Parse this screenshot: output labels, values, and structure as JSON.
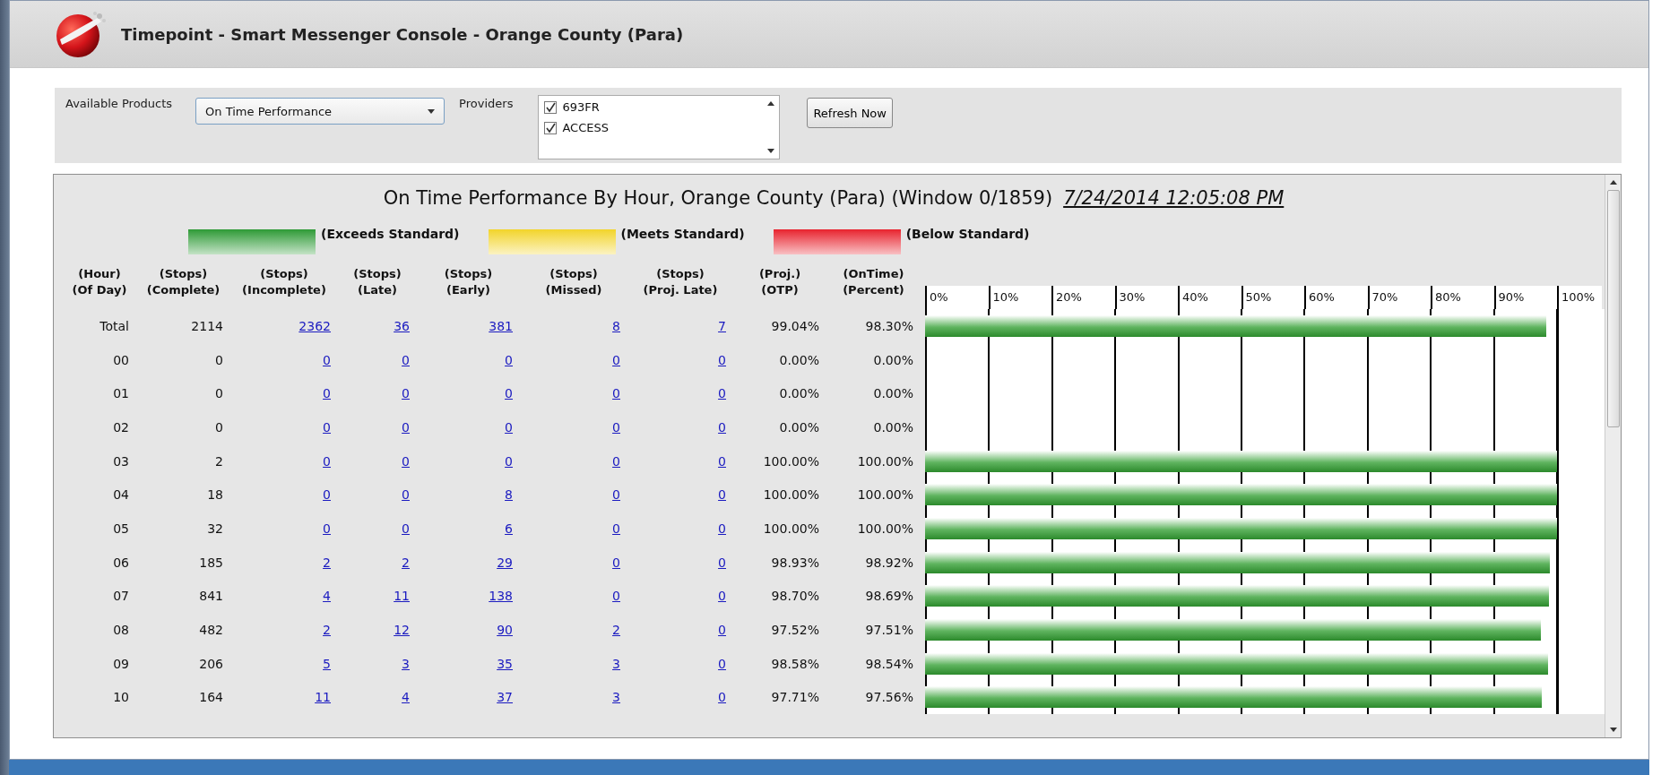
{
  "window": {
    "title": "Timepoint - Smart Messenger Console - Orange County (Para)"
  },
  "controls": {
    "products_label": "Available Products",
    "product": "On Time Performance",
    "providers_label": "Providers",
    "providers": [
      {
        "label": "693FR",
        "checked": true
      },
      {
        "label": "ACCESS",
        "checked": true
      }
    ],
    "refresh_button": "Refresh Now"
  },
  "report": {
    "title": "On Time Performance By Hour, Orange County (Para) (Window 0/1859)",
    "timestamp": "7/24/2014 12:05:08 PM",
    "legend": [
      {
        "label": "(Exceeds Standard)",
        "color": "#2e9a36"
      },
      {
        "label": "(Meets Standard)",
        "color": "#f2d42a"
      },
      {
        "label": "(Below Standard)",
        "color": "#e8232e"
      }
    ],
    "columns": [
      {
        "label": "(Hour)\n(Of Day)",
        "link": false
      },
      {
        "label": "(Stops)\n(Complete)",
        "link": false
      },
      {
        "label": "(Stops)\n(Incomplete)",
        "link": true
      },
      {
        "label": "(Stops)\n(Late)",
        "link": true
      },
      {
        "label": "(Stops)\n(Early)",
        "link": true
      },
      {
        "label": "(Stops)\n(Missed)",
        "link": true
      },
      {
        "label": "(Stops)\n(Proj. Late)",
        "link": true
      },
      {
        "label": "(Proj.)\n(OTP)",
        "link": false
      },
      {
        "label": "(OnTime)\n(Percent)",
        "link": false
      }
    ],
    "scale": [
      "0%",
      "10%",
      "20%",
      "30%",
      "40%",
      "50%",
      "60%",
      "70%",
      "80%",
      "90%",
      "100%"
    ],
    "rows": [
      {
        "cells": [
          "Total",
          "2114",
          "2362",
          "36",
          "381",
          "8",
          "7",
          "99.04%",
          "98.30%"
        ],
        "level": 0.983
      },
      {
        "cells": [
          "00",
          "0",
          "0",
          "0",
          "0",
          "0",
          "0",
          "0.00%",
          "0.00%"
        ]
      },
      {
        "cells": [
          "01",
          "0",
          "0",
          "0",
          "0",
          "0",
          "0",
          "0.00%",
          "0.00%"
        ]
      },
      {
        "cells": [
          "02",
          "0",
          "0",
          "0",
          "0",
          "0",
          "0",
          "0.00%",
          "0.00%"
        ]
      },
      {
        "cells": [
          "03",
          "2",
          "0",
          "0",
          "0",
          "0",
          "0",
          "100.00%",
          "100.00%"
        ],
        "level": 1
      },
      {
        "cells": [
          "04",
          "18",
          "0",
          "0",
          "8",
          "0",
          "0",
          "100.00%",
          "100.00%"
        ],
        "level": 1
      },
      {
        "cells": [
          "05",
          "32",
          "0",
          "0",
          "6",
          "0",
          "0",
          "100.00%",
          "100.00%"
        ],
        "level": 1
      },
      {
        "cells": [
          "06",
          "185",
          "2",
          "2",
          "29",
          "0",
          "0",
          "98.93%",
          "98.92%"
        ],
        "level": 0.9892
      },
      {
        "cells": [
          "07",
          "841",
          "4",
          "11",
          "138",
          "0",
          "0",
          "98.70%",
          "98.69%"
        ],
        "level": 0.9869
      },
      {
        "cells": [
          "08",
          "482",
          "2",
          "12",
          "90",
          "2",
          "0",
          "97.52%",
          "97.51%"
        ],
        "level": 0.9751
      },
      {
        "cells": [
          "09",
          "206",
          "5",
          "3",
          "35",
          "3",
          "0",
          "98.58%",
          "98.54%"
        ],
        "level": 0.9854
      },
      {
        "cells": [
          "10",
          "164",
          "11",
          "4",
          "37",
          "3",
          "0",
          "97.71%",
          "97.56%"
        ],
        "level": 0.9756
      }
    ]
  }
}
